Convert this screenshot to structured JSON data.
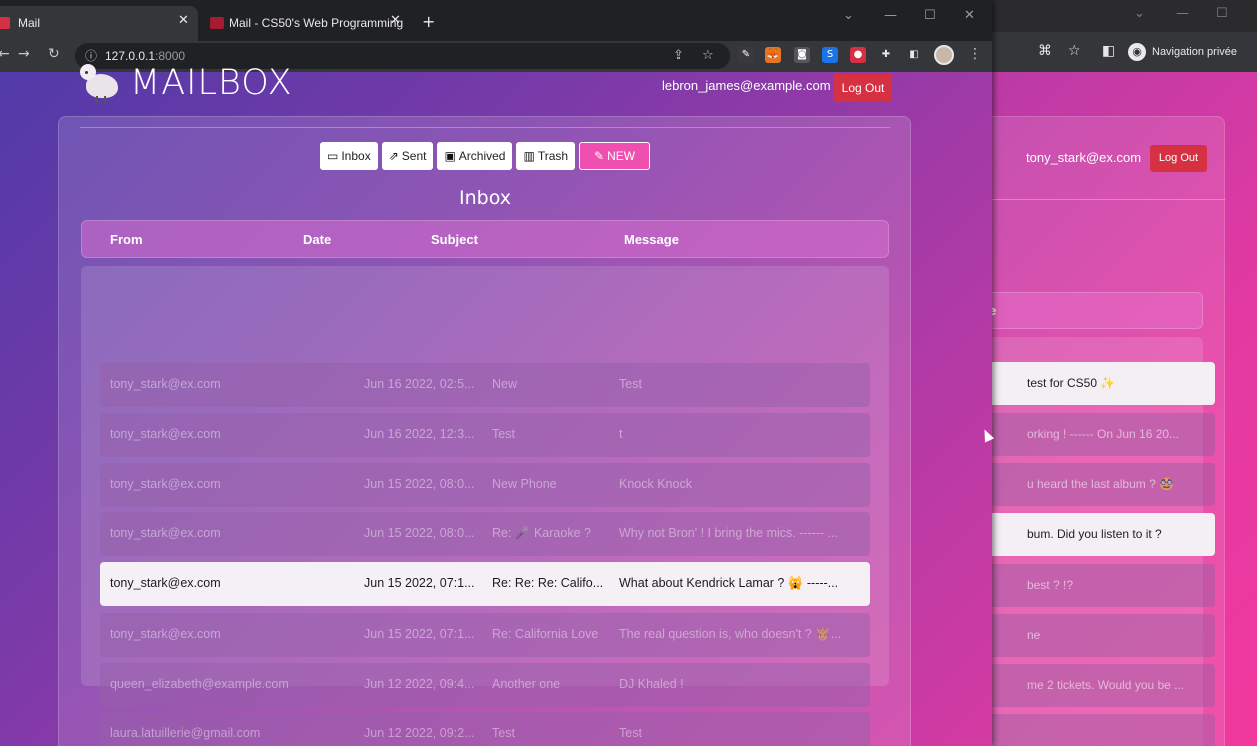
{
  "browser": {
    "tabs": [
      {
        "title": "Mail",
        "active": true
      },
      {
        "title": "Mail - CS50's Web Programming",
        "active": false
      }
    ],
    "url_host": "127.0.0.1",
    "url_port": ":8000"
  },
  "header": {
    "logo_text": "MAILBOX",
    "user_email": "lebron_james@example.com",
    "logout_label": "Log Out"
  },
  "nav": {
    "inbox": "Inbox",
    "sent": "Sent",
    "archived": "Archived",
    "trash": "Trash",
    "new": "NEW"
  },
  "mailbox_title": "Inbox",
  "columns": [
    "From",
    "Date",
    "Subject",
    "Message"
  ],
  "emails": [
    {
      "from": "tony_stark@ex.com",
      "date": "Jun 16 2022, 02:5...",
      "subject": "New",
      "message": "Test",
      "unread": false
    },
    {
      "from": "tony_stark@ex.com",
      "date": "Jun 16 2022, 12:3...",
      "subject": "Test",
      "message": "t",
      "unread": false
    },
    {
      "from": "tony_stark@ex.com",
      "date": "Jun 15 2022, 08:0...",
      "subject": "New Phone",
      "message": "Knock Knock",
      "unread": false
    },
    {
      "from": "tony_stark@ex.com",
      "date": "Jun 15 2022, 08:0...",
      "subject": "Re: 🎤 Karaoke ?",
      "message": "Why not Bron' ! I bring the mics. ------ ...",
      "unread": false
    },
    {
      "from": "tony_stark@ex.com",
      "date": "Jun 15 2022, 07:1...",
      "subject": "Re: Re: Re: Califo...",
      "message": "What about Kendrick Lamar ? 🙀 -----...",
      "unread": true
    },
    {
      "from": "tony_stark@ex.com",
      "date": "Jun 15 2022, 07:1...",
      "subject": "Re: California Love",
      "message": "The real question is, who doesn't ? 🤴...",
      "unread": false
    },
    {
      "from": "queen_elizabeth@example.com",
      "date": "Jun 12 2022, 09:4...",
      "subject": "Another one",
      "message": "DJ Khaled !",
      "unread": false
    },
    {
      "from": "laura.latuillerie@gmail.com",
      "date": "Jun 12 2022, 09:2...",
      "subject": "Test",
      "message": "Test",
      "unread": false
    }
  ],
  "back_window": {
    "private_label": "Navigation privée",
    "user_email": "tony_stark@ex.com",
    "logout_label": "Log Out",
    "header_fragment": "ge",
    "rows": [
      {
        "text": "test for CS50 ✨",
        "unread": true
      },
      {
        "text": "orking ! ------ On Jun 16 20...",
        "unread": false
      },
      {
        "text": "u heard the last album ? 🥸",
        "unread": false
      },
      {
        "text": "bum. Did you listen to it ?",
        "unread": true
      },
      {
        "text": "best ? !?",
        "unread": false
      },
      {
        "text": "ne",
        "unread": false
      },
      {
        "text": "me 2 tickets. Would you be ...",
        "unread": false
      },
      {
        "text": "",
        "unread": false
      }
    ]
  }
}
